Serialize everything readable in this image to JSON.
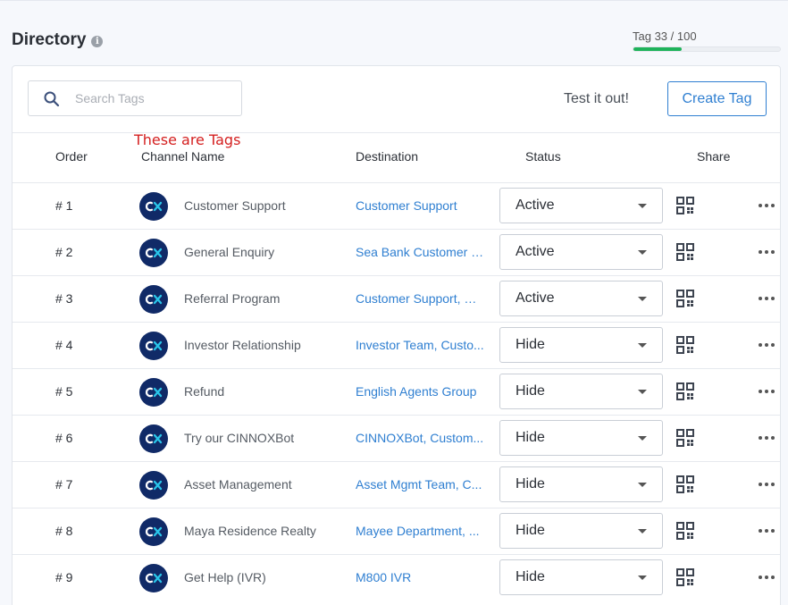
{
  "page": {
    "title": "Directory"
  },
  "quota": {
    "label": "Tag 33 / 100",
    "used": 33,
    "total": 100
  },
  "toolbar": {
    "search_placeholder": "Search Tags",
    "test_link": "Test it out!",
    "create_button": "Create Tag"
  },
  "annotation": "These are Tags",
  "columns": {
    "order": "Order",
    "channel": "Channel Name",
    "destination": "Destination",
    "status": "Status",
    "share": "Share"
  },
  "rows": [
    {
      "order": "# 1",
      "channel": "Customer Support",
      "destination": "Customer Support",
      "status": "Active"
    },
    {
      "order": "# 2",
      "channel": "General Enquiry",
      "destination": "Sea Bank Customer S...",
      "status": "Active"
    },
    {
      "order": "# 3",
      "channel": "Referral Program",
      "destination": "Customer Support, Gr...",
      "status": "Active"
    },
    {
      "order": "# 4",
      "channel": "Investor Relationship",
      "destination": "Investor Team, Custo...",
      "status": "Hide"
    },
    {
      "order": "# 5",
      "channel": "Refund",
      "destination": "English Agents Group",
      "status": "Hide"
    },
    {
      "order": "# 6",
      "channel": "Try our CINNOXBot",
      "destination": "CINNOXBot, Custom...",
      "status": "Hide"
    },
    {
      "order": "# 7",
      "channel": "Asset Management",
      "destination": "Asset Mgmt Team, C...",
      "status": "Hide"
    },
    {
      "order": "# 8",
      "channel": "Maya Residence Realty",
      "destination": "Mayee Department, ...",
      "status": "Hide"
    },
    {
      "order": "# 9",
      "channel": "Get Help (IVR)",
      "destination": "M800 IVR",
      "status": "Hide"
    }
  ],
  "icons": {
    "avatar": "cinnox-logo",
    "share": "qr-code-icon",
    "more": "more-horizontal-icon"
  },
  "colors": {
    "accent": "#2f7fd1",
    "progress": "#1fb35b",
    "annotation": "#d42020",
    "avatar_bg": "#102a67"
  }
}
